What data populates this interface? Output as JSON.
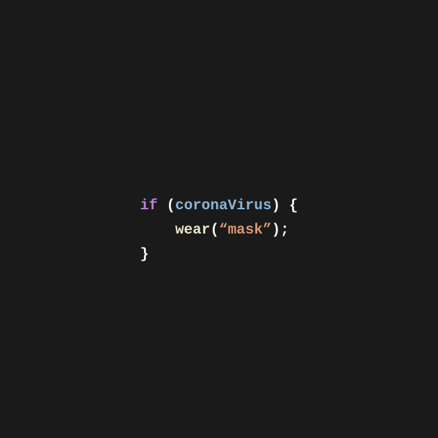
{
  "code": {
    "keyword": "if",
    "space1": " ",
    "openParen": "(",
    "condition": "coronaVirus",
    "closeParen": ")",
    "space2": " ",
    "openBrace": "{",
    "funcName": "wear",
    "funcOpenParen": "(",
    "stringOpenQuote": "“",
    "stringValue": "mask",
    "stringCloseQuote": "”",
    "funcCloseParen": ")",
    "semicolon": ";",
    "closeBrace": "}"
  }
}
